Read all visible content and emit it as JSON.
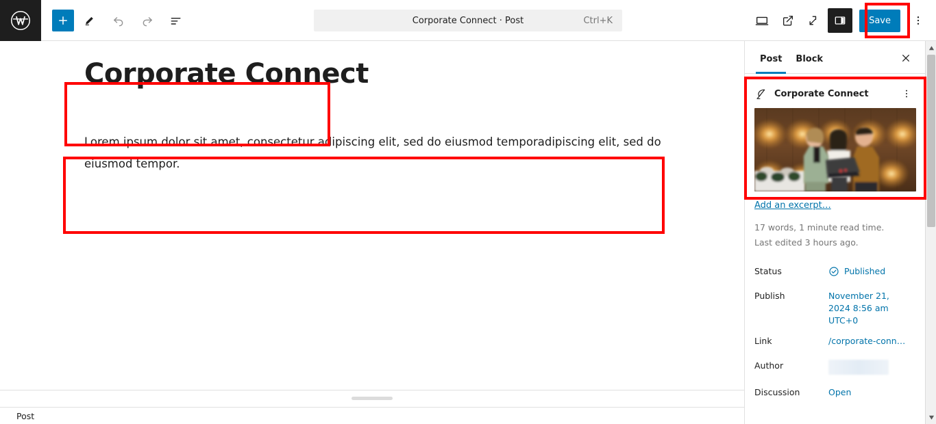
{
  "app": {
    "name": "WordPress Block Editor",
    "logo_icon": "wordpress-logo-icon"
  },
  "toolbar": {
    "add_block_label": "+",
    "add_block_icon": "plus-icon",
    "tools_icon": "pencil-icon",
    "undo_icon": "undo-arrow-icon",
    "redo_icon": "redo-arrow-icon",
    "list_view_icon": "list-view-icon",
    "command_center": {
      "title": "Corporate Connect · Post",
      "shortcut": "Ctrl+K"
    },
    "view_icon": "desktop-monitor-icon",
    "preview_icon": "external-link-icon",
    "fullscreen_icon": "fullscreen-expand-icon",
    "sidebar_toggle_icon": "settings-panel-icon",
    "save_label": "Save",
    "options_icon": "kebab-menu-icon"
  },
  "editor": {
    "title": "Corporate Connect",
    "paragraph": "Lorem ipsum dolor sit amet, consectetur adipiscing elit, sed do eiusmod temporadipiscing elit, sed do eiusmod tempor.",
    "breadcrumb": "Post",
    "drag_handle_icon": "resize-handle-icon"
  },
  "sidebar": {
    "tabs": [
      {
        "label": "Post",
        "active": true
      },
      {
        "label": "Block",
        "active": false
      }
    ],
    "close_icon": "close-x-icon",
    "featured": {
      "icon": "quill-feather-icon",
      "title": "Corporate Connect",
      "menu_icon": "kebab-menu-icon",
      "thumbnail_alt": "three-people-with-laptop-photo"
    },
    "excerpt_link": "Add an excerpt…",
    "word_count": "17 words, 1 minute read time.",
    "last_edited": "Last edited 3 hours ago.",
    "properties": [
      {
        "label": "Status",
        "value": "Published",
        "icon": "check-circle-icon",
        "redacted": false
      },
      {
        "label": "Publish",
        "value": "November 21, 2024 8:56 am UTC+0",
        "icon": "",
        "redacted": false
      },
      {
        "label": "Link",
        "value": "/corporate-conn…",
        "icon": "",
        "redacted": false
      },
      {
        "label": "Author",
        "value": "",
        "icon": "",
        "redacted": true
      },
      {
        "label": "Discussion",
        "value": "Open",
        "icon": "",
        "redacted": false
      }
    ],
    "scrollbar": {
      "up_icon": "scroll-up-arrow-icon",
      "down_icon": "scroll-down-arrow-icon"
    }
  },
  "annotations": {
    "highlight_color": "#ff0000",
    "targets": [
      "save-button",
      "post-title",
      "post-paragraph",
      "featured-image-card"
    ]
  },
  "colors": {
    "accent": "#007cba",
    "link": "#0073aa",
    "dark": "#1e1e1e",
    "muted": "#757575",
    "highlight": "#ff0000"
  }
}
